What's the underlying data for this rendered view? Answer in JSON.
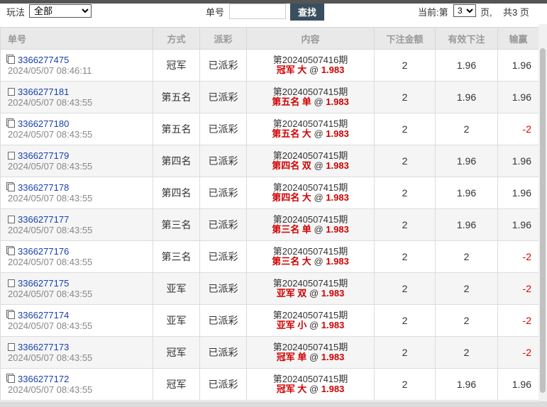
{
  "filter": {
    "play_label": "玩法",
    "play_value": "全部",
    "order_label": "单号",
    "order_value": "",
    "search_label": "查找",
    "page_prefix": "当前:第",
    "page_value": "3",
    "page_suffix": "页,",
    "page_total": "共3 页"
  },
  "table": {
    "headers": [
      "单号",
      "方式",
      "派彩",
      "内容",
      "下注金额",
      "有效下注",
      "输赢"
    ],
    "rows": [
      {
        "id": "3366277475",
        "time": "2024/05/07 08:46:11",
        "method": "冠军",
        "status": "已派彩",
        "period": "第20240507416期",
        "pick": "冠军 大",
        "at": "@",
        "odds": "1.983",
        "amount": "2",
        "valid": "1.96",
        "win": "1.96"
      },
      {
        "id": "3366277181",
        "time": "2024/05/07 08:43:55",
        "method": "第五名",
        "status": "已派彩",
        "period": "第20240507415期",
        "pick": "第五名 单",
        "at": "@",
        "odds": "1.983",
        "amount": "2",
        "valid": "1.96",
        "win": "1.96"
      },
      {
        "id": "3366277180",
        "time": "2024/05/07 08:43:55",
        "method": "第五名",
        "status": "已派彩",
        "period": "第20240507415期",
        "pick": "第五名 大",
        "at": "@",
        "odds": "1.983",
        "amount": "2",
        "valid": "2",
        "win": "-2"
      },
      {
        "id": "3366277179",
        "time": "2024/05/07 08:43:55",
        "method": "第四名",
        "status": "已派彩",
        "period": "第20240507415期",
        "pick": "第四名 双",
        "at": "@",
        "odds": "1.983",
        "amount": "2",
        "valid": "1.96",
        "win": "1.96"
      },
      {
        "id": "3366277178",
        "time": "2024/05/07 08:43:55",
        "method": "第四名",
        "status": "已派彩",
        "period": "第20240507415期",
        "pick": "第四名 大",
        "at": "@",
        "odds": "1.983",
        "amount": "2",
        "valid": "1.96",
        "win": "1.96"
      },
      {
        "id": "3366277177",
        "time": "2024/05/07 08:43:55",
        "method": "第三名",
        "status": "已派彩",
        "period": "第20240507415期",
        "pick": "第三名 单",
        "at": "@",
        "odds": "1.983",
        "amount": "2",
        "valid": "1.96",
        "win": "1.96"
      },
      {
        "id": "3366277176",
        "time": "2024/05/07 08:43:55",
        "method": "第三名",
        "status": "已派彩",
        "period": "第20240507415期",
        "pick": "第三名 大",
        "at": "@",
        "odds": "1.983",
        "amount": "2",
        "valid": "2",
        "win": "-2"
      },
      {
        "id": "3366277175",
        "time": "2024/05/07 08:43:55",
        "method": "亚军",
        "status": "已派彩",
        "period": "第20240507415期",
        "pick": "亚军 双",
        "at": "@",
        "odds": "1.983",
        "amount": "2",
        "valid": "2",
        "win": "-2"
      },
      {
        "id": "3366277174",
        "time": "2024/05/07 08:43:55",
        "method": "亚军",
        "status": "已派彩",
        "period": "第20240507415期",
        "pick": "亚军 小",
        "at": "@",
        "odds": "1.983",
        "amount": "2",
        "valid": "2",
        "win": "-2"
      },
      {
        "id": "3366277173",
        "time": "2024/05/07 08:43:55",
        "method": "冠军",
        "status": "已派彩",
        "period": "第20240507415期",
        "pick": "冠军 单",
        "at": "@",
        "odds": "1.983",
        "amount": "2",
        "valid": "2",
        "win": "-2"
      },
      {
        "id": "3366277172",
        "time": "2024/05/07 08:43:55",
        "method": "冠军",
        "status": "已派彩",
        "period": "第20240507415期",
        "pick": "冠军 大",
        "at": "@",
        "odds": "1.983",
        "amount": "2",
        "valid": "1.96",
        "win": "1.96"
      }
    ]
  },
  "colors": {
    "pick_red": "#d00000",
    "loss_red": "#e00000",
    "link_blue": "#1a3fb0",
    "search_button_bg": "#3a4f5e"
  },
  "icons": {
    "order_icon": "document-icon"
  }
}
